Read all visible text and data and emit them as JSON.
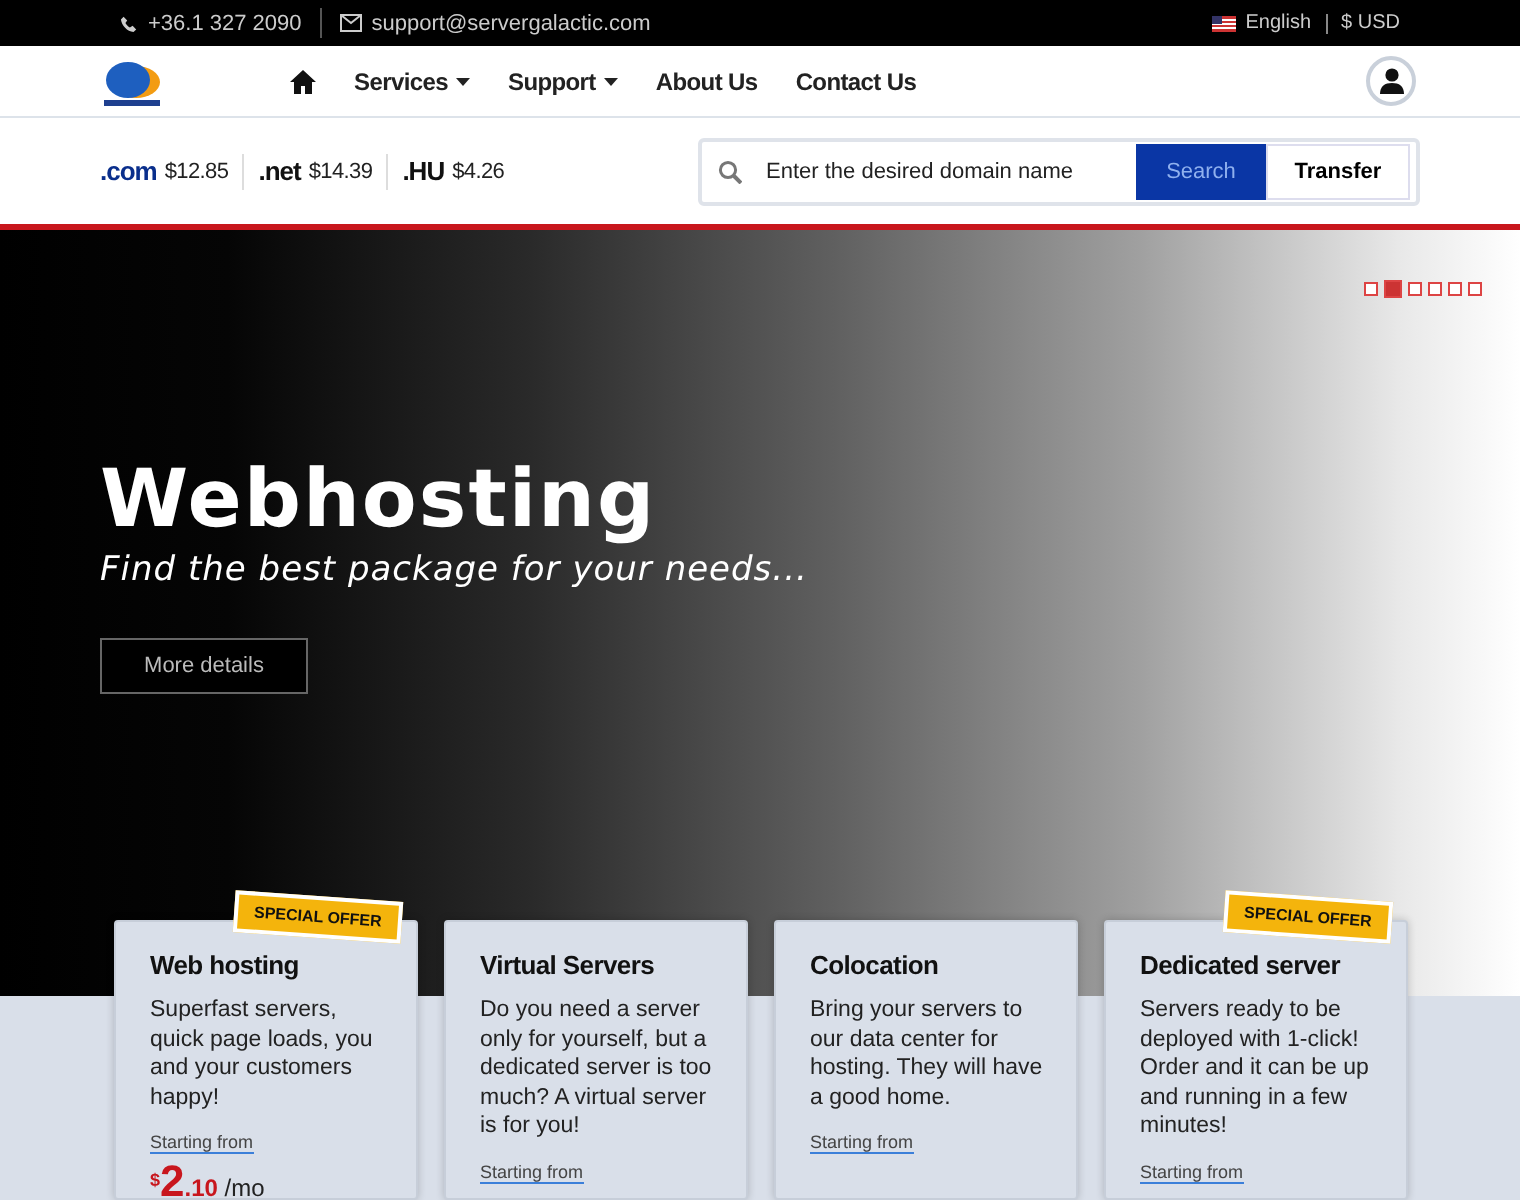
{
  "topbar": {
    "phone": "+36.1 327 2090",
    "email": "support@servergalactic.com",
    "language": "English",
    "currency": "$ USD"
  },
  "nav": {
    "items": [
      {
        "label": "Services",
        "dropdown": true
      },
      {
        "label": "Support",
        "dropdown": true
      },
      {
        "label": "About Us",
        "dropdown": false
      },
      {
        "label": "Contact Us",
        "dropdown": false
      }
    ]
  },
  "domain_prices": [
    {
      "tld": ".com",
      "price": "$12.85",
      "color": "#0a2f8c"
    },
    {
      "tld": ".net",
      "price": "$14.39",
      "color": "#111111"
    },
    {
      "tld": ".HU",
      "price": "$4.26",
      "color": "#111111"
    }
  ],
  "domain_search": {
    "placeholder": "Enter the desired domain name",
    "search_button": "Search",
    "transfer_button": "Transfer"
  },
  "hero": {
    "title": "Webhosting",
    "subtitle": "Find the best package for your needs...",
    "button": "More details",
    "slides": [
      {
        "selected": false
      },
      {
        "selected": true
      },
      {
        "selected": false
      },
      {
        "selected": false
      },
      {
        "selected": false
      },
      {
        "selected": false
      }
    ]
  },
  "cards": [
    {
      "title": "Web hosting",
      "badge": "SPECIAL OFFER",
      "description": "Superfast servers, quick page loads, you and your customers happy!",
      "starting_from": "Starting from",
      "price": {
        "currency": "$",
        "whole": "2",
        "cents": ".10",
        "period": "/mo"
      }
    },
    {
      "title": "Virtual Servers",
      "description": "Do you need a server only for yourself, but a dedicated server is too much? A virtual server is for you!",
      "starting_from": "Starting from"
    },
    {
      "title": "Colocation",
      "description": "Bring your servers to our data center for hosting. They will have a good home.",
      "starting_from": "Starting from"
    },
    {
      "title": "Dedicated server",
      "badge": "SPECIAL OFFER",
      "description": "Servers ready to be deployed with 1-click! Order and it can be up and running in a few minutes!",
      "starting_from": "Starting from"
    }
  ]
}
